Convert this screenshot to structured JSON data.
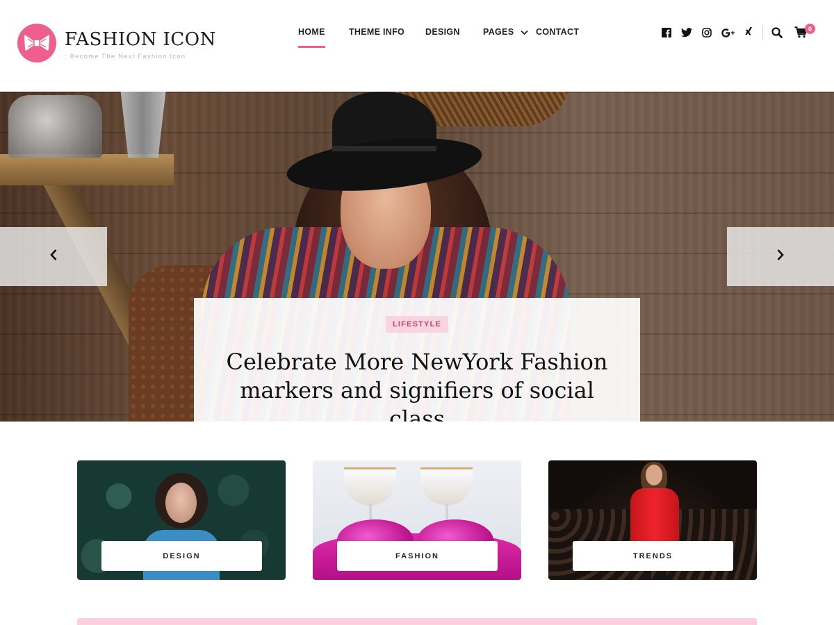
{
  "site": {
    "title": "FASHION ICON",
    "tagline": ": Become The Next Fashion Icon"
  },
  "nav": {
    "items": [
      {
        "label": "HOME",
        "active": true
      },
      {
        "label": "THEME INFO",
        "active": false
      },
      {
        "label": "DESIGN",
        "active": false
      },
      {
        "label": "PAGES",
        "active": false,
        "has_dropdown": true
      },
      {
        "label": "CONTACT",
        "active": false
      }
    ]
  },
  "social": {
    "icons": [
      "facebook-icon",
      "twitter-icon",
      "instagram-icon",
      "google-plus-icon",
      "xing-icon"
    ]
  },
  "header_tools": {
    "search_icon": "search-icon",
    "cart_icon": "cart-icon",
    "cart_count": "0"
  },
  "hero": {
    "category": "LIFESTYLE",
    "title": "Celebrate More NewYork Fashion markers and signifiers of social class",
    "prev_icon": "chevron-left-icon",
    "next_icon": "chevron-right-icon"
  },
  "categories": [
    {
      "label": "DESIGN"
    },
    {
      "label": "FASHION"
    },
    {
      "label": "TRENDS"
    }
  ],
  "colors": {
    "accent": "#ee5f8e",
    "badge_bg": "#fad4df",
    "badge_text": "#c7436f",
    "bottom_bar": "#fbcfdc"
  }
}
